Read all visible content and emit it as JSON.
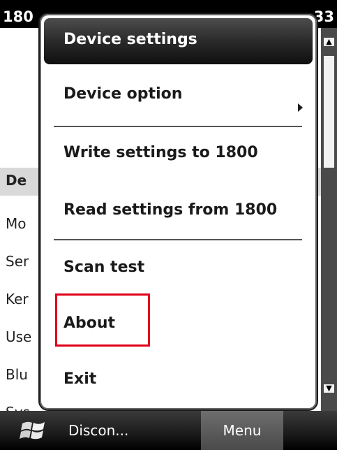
{
  "status_bar": {
    "left_text": "180",
    "right_text": "33"
  },
  "background_app": {
    "section_header": "De",
    "rows": [
      "Mo",
      "Ser",
      "Ker",
      "Use",
      "Blu",
      "Sys"
    ]
  },
  "menu": {
    "header": "Device settings",
    "items": {
      "device_option": "Device option",
      "write_settings": "Write settings to 1800",
      "read_settings": "Read settings from 1800",
      "scan_test": "Scan test",
      "about": "About",
      "exit": "Exit"
    },
    "highlight_color": "#e0001a"
  },
  "bottom_bar": {
    "start_icon": "windows-flag-icon",
    "left_soft_key": "Discon...",
    "right_soft_key": "Menu"
  }
}
